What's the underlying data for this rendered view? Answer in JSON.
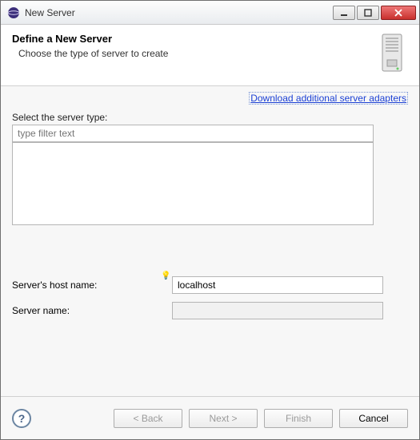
{
  "window": {
    "title": "New Server"
  },
  "banner": {
    "title": "Define a New Server",
    "subtitle": "Choose the type of server to create"
  },
  "link": {
    "download": "Download additional server adapters"
  },
  "labels": {
    "select_type": "Select the server type:",
    "filter_placeholder": "type filter text",
    "host_name": "Server's host name:",
    "server_name": "Server name:"
  },
  "fields": {
    "host_name": "localhost",
    "server_name": ""
  },
  "buttons": {
    "back": "< Back",
    "next": "Next >",
    "finish": "Finish",
    "cancel": "Cancel"
  },
  "icons": {
    "app": "eclipse-icon",
    "banner": "server-tower-icon",
    "bulb": "lightbulb-icon",
    "help": "help-icon",
    "minimize": "minimize-icon",
    "maximize": "maximize-icon",
    "close": "close-icon"
  }
}
